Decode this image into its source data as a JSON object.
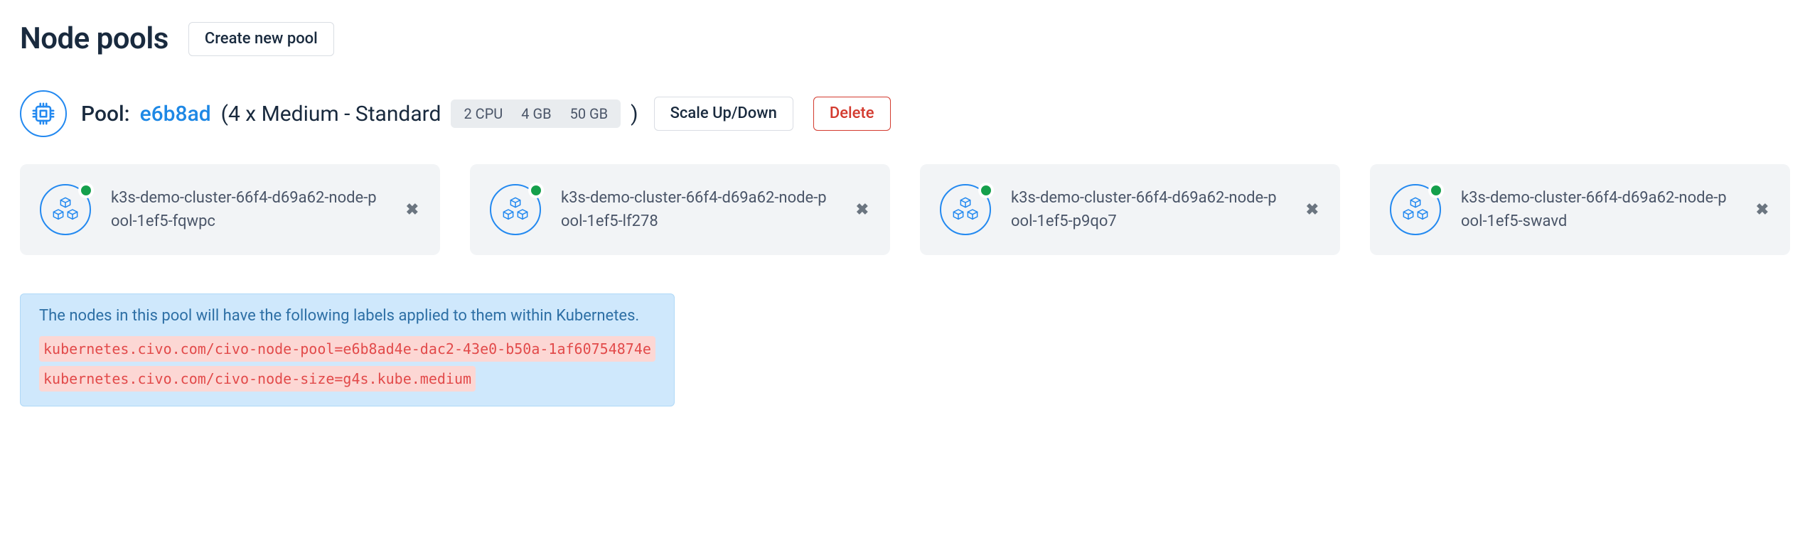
{
  "header": {
    "title": "Node pools",
    "create_btn": "Create new pool"
  },
  "pool": {
    "prefix": "Pool:",
    "id": "e6b8ad",
    "desc": "(4 x Medium - Standard",
    "specs": {
      "cpu": "2 CPU",
      "ram": "4 GB",
      "disk": "50 GB"
    },
    "close_paren": ")",
    "scale_btn": "Scale Up/Down",
    "delete_btn": "Delete"
  },
  "nodes": [
    {
      "name": "k3s-demo-cluster-66f4-d69a62-node-pool-1ef5-fqwpc"
    },
    {
      "name": "k3s-demo-cluster-66f4-d69a62-node-pool-1ef5-lf278"
    },
    {
      "name": "k3s-demo-cluster-66f4-d69a62-node-pool-1ef5-p9qo7"
    },
    {
      "name": "k3s-demo-cluster-66f4-d69a62-node-pool-1ef5-swavd"
    }
  ],
  "info": {
    "message": "The nodes in this pool will have the following labels applied to them within Kubernetes.",
    "labels": [
      "kubernetes.civo.com/civo-node-pool=e6b8ad4e-dac2-43e0-b50a-1af60754874e",
      "kubernetes.civo.com/civo-node-size=g4s.kube.medium"
    ]
  },
  "icons": {
    "close": "✖"
  }
}
